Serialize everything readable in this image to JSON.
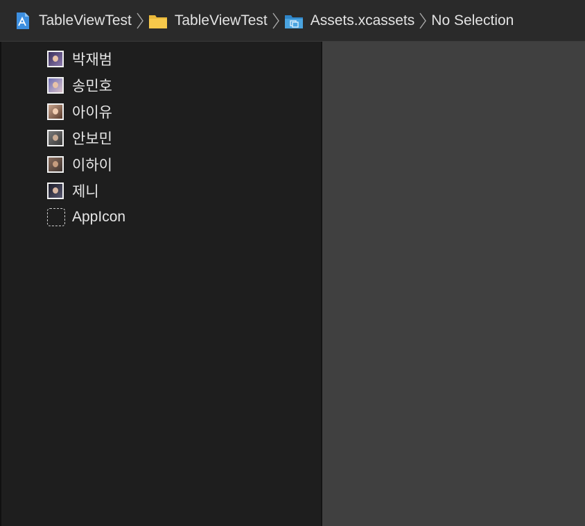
{
  "breadcrumb": {
    "items": [
      {
        "label": "TableViewTest",
        "icon": "xcode-project-icon"
      },
      {
        "label": "TableViewTest",
        "icon": "folder-icon"
      },
      {
        "label": "Assets.xcassets",
        "icon": "asset-catalog-icon"
      },
      {
        "label": "No Selection",
        "icon": ""
      }
    ]
  },
  "navigator": {
    "assets": [
      {
        "label": "박재범",
        "icon": "image-set-icon",
        "colors": [
          "#3a2f5c",
          "#c9b8d8"
        ]
      },
      {
        "label": "송민호",
        "icon": "image-set-icon",
        "colors": [
          "#6f6fb5",
          "#d8c0c8"
        ]
      },
      {
        "label": "아이유",
        "icon": "image-set-icon",
        "colors": [
          "#5a3b2c",
          "#e1b99a"
        ]
      },
      {
        "label": "안보민",
        "icon": "image-set-icon",
        "colors": [
          "#4a4a4a",
          "#bfa18a"
        ]
      },
      {
        "label": "이하이",
        "icon": "image-set-icon",
        "colors": [
          "#3f3430",
          "#c69c7e"
        ]
      },
      {
        "label": "제니",
        "icon": "image-set-icon",
        "colors": [
          "#1d1d2a",
          "#d9b7a2"
        ]
      },
      {
        "label": "AppIcon",
        "icon": "app-icon-placeholder-icon"
      }
    ]
  },
  "colors": {
    "pathbar_bg": "#2a2a2a",
    "navigator_bg": "#1e1e1e",
    "editor_bg": "#404040",
    "folder_yellow": "#f3c443",
    "catalog_blue": "#4aa3df"
  }
}
